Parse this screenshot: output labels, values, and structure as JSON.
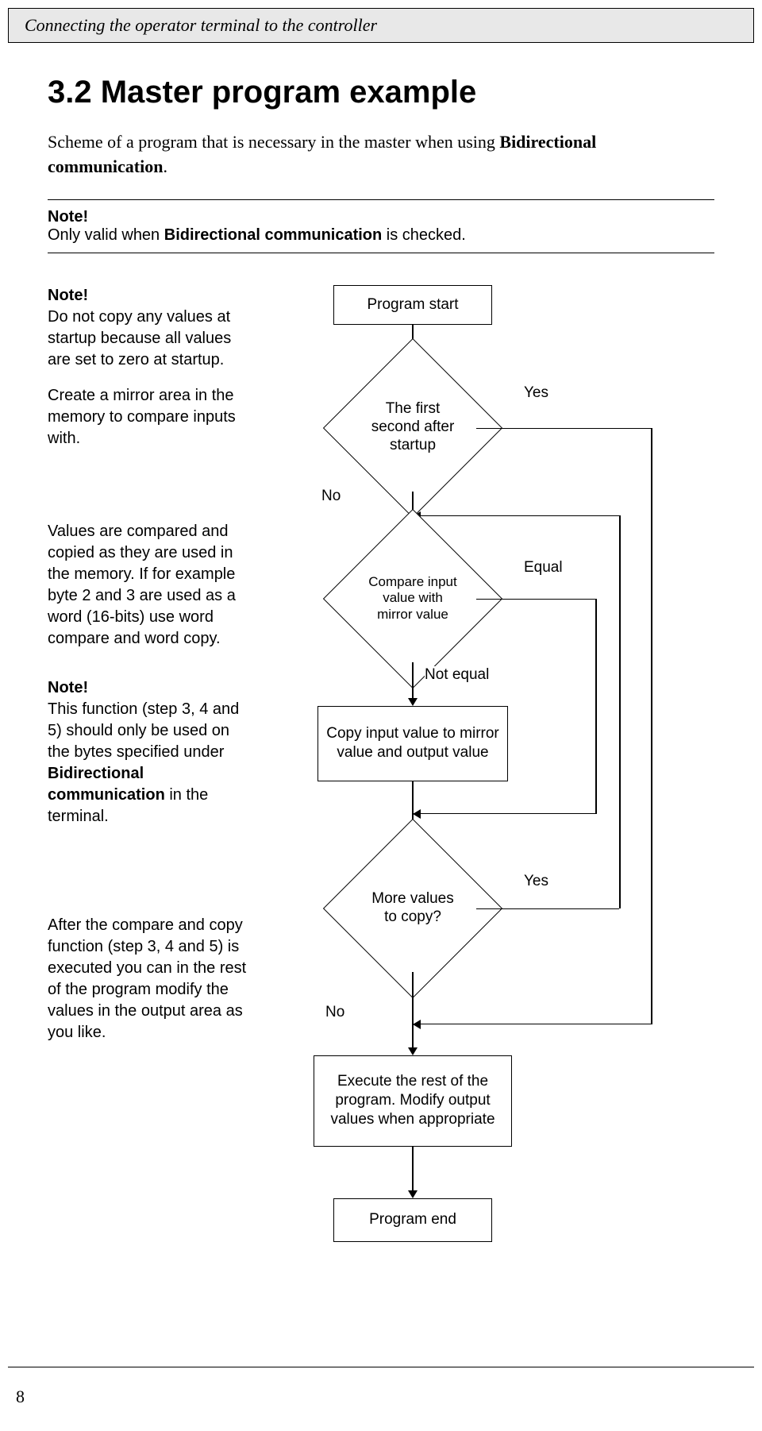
{
  "header": "Connecting the operator terminal to the controller",
  "section_title": "3.2 Master program example",
  "intro_p1": "Scheme of a program that is necessary in the master when using ",
  "intro_bold": "Bidirectional communication",
  "intro_p2": ".",
  "note1_title": "Note!",
  "note1_body_a": "Only valid when ",
  "note1_body_bold": "Bidirectional communication",
  "note1_body_b": " is checked.",
  "side": {
    "n1_title": "Note!",
    "n1_body": "Do not copy any values at startup because all values are set to zero at startup.",
    "n1_body2": "Create a mirror area in the memory to compare inputs with.",
    "n2": "Values are compared and copied as they are used in the memory. If for example byte 2 and 3 are used as a word (16-bits) use word compare and word copy.",
    "n3_title": "Note!",
    "n3_body_a": "This function (step 3, 4 and 5) should only be used on the bytes specified under ",
    "n3_body_bold": "Bidirectional communication",
    "n3_body_b": " in the terminal.",
    "n4": "After the compare and copy function (step 3, 4 and 5) is executed you can in the rest of the program modify the values in the output area as you like."
  },
  "flow": {
    "start": "Program start",
    "d1": "The first second after startup",
    "d1_yes": "Yes",
    "d1_no": "No",
    "d2": "Compare input value with mirror value",
    "d2_equal": "Equal",
    "d2_ne": "Not equal",
    "copy": "Copy input value to mirror value and output value",
    "d3": "More values to copy?",
    "d3_yes": "Yes",
    "d3_no": "No",
    "exec": "Execute the rest of the program. Modify output values when appropriate",
    "end": "Program end"
  },
  "page": "8"
}
